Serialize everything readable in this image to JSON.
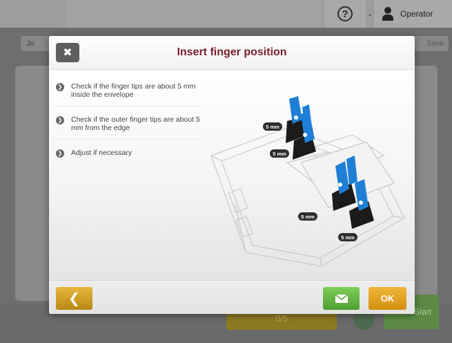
{
  "topbar": {
    "help_icon": "question-circle-icon",
    "user_icon": "user-icon",
    "user_label": "Operator"
  },
  "background": {
    "jobs_label": "Jo",
    "save_label": "Save",
    "counter_value": "0/5",
    "start_label": "Start"
  },
  "dialog": {
    "title": "Insert finger position",
    "steps": [
      "Check if the finger tips are about 5 mm inside the envelope",
      "Check if the outer finger tips are about 5 mm from the edge",
      "Adjust if necessary"
    ],
    "measure_labels": [
      "5 mm",
      "5 mm",
      "5 mm",
      "5 mm"
    ],
    "footer": {
      "back_icon": "chevron-left-icon",
      "mail_icon": "envelope-icon",
      "ok_label": "OK"
    }
  },
  "colors": {
    "title": "#7a1f2b",
    "back_button": "#d0a02a",
    "mail_button": "#62b140",
    "ok_button": "#e3a224",
    "finger_blue": "#1f7fd6"
  }
}
